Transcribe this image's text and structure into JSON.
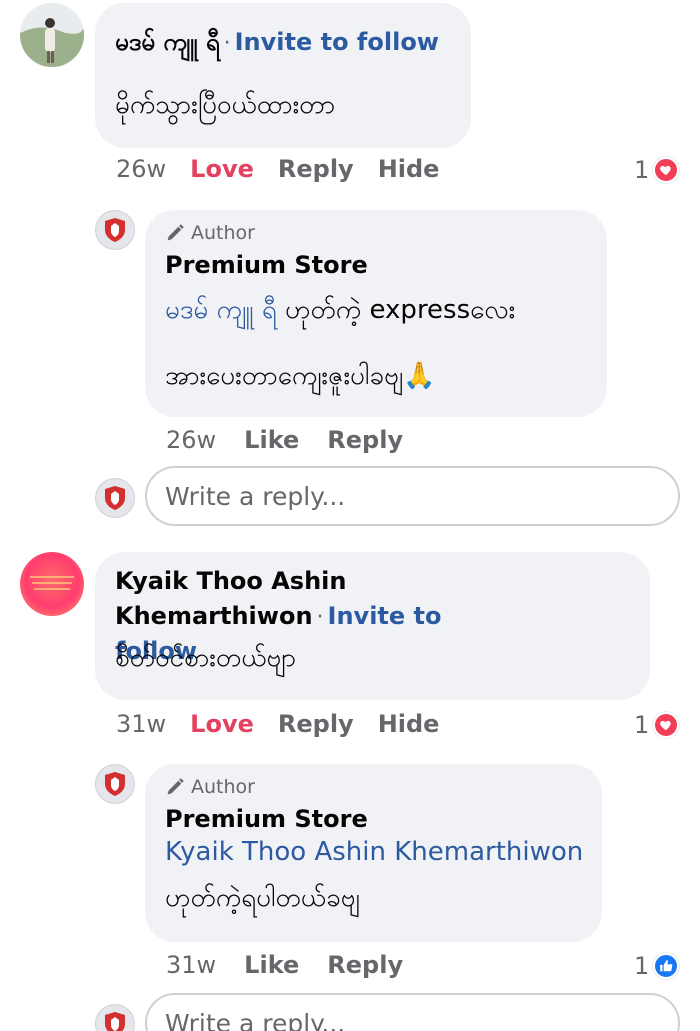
{
  "comments": [
    {
      "name": "မဒမ် ကျူ ရီ",
      "invite": "Invite to follow",
      "text": "မိုက်သွားပြီဝယ်ထားတာ",
      "time": "26w",
      "actions": [
        "Love",
        "Reply",
        "Hide"
      ],
      "reaction_count": "1",
      "reaction_icon": "heart-icon",
      "reply": {
        "badge": "Author",
        "name": "Premium Store",
        "mention": "မဒမ် ကျူ ရီ",
        "text_line1": " ဟုတ်ကဲ့ expressလေး",
        "text_line2": "အားပေးတာကျေးဇူးပါခဗျ🙏",
        "time": "26w",
        "actions": [
          "Like",
          "Reply"
        ]
      },
      "reply_placeholder": "Write a reply..."
    },
    {
      "name": "Kyaik Thoo Ashin Khemarthiwon",
      "invite_line1": "Invite to",
      "invite_line2": "follow",
      "text": "စိတ်ဝင်စားတယ်ဗျာ",
      "time": "31w",
      "actions": [
        "Love",
        "Reply",
        "Hide"
      ],
      "reaction_count": "1",
      "reaction_icon": "heart-icon",
      "reply": {
        "badge": "Author",
        "name": "Premium Store",
        "mention": "Kyaik Thoo Ashin Khemarthiwon",
        "text": "ဟုတ်ကဲ့ရပါတယ်ခဗျ",
        "time": "31w",
        "actions": [
          "Like",
          "Reply"
        ],
        "reaction_count": "1",
        "reaction_icon": "like-icon"
      },
      "reply_placeholder": "Write a reply..."
    }
  ],
  "colors": {
    "link": "#2c5aa0",
    "love": "#e4405f",
    "meta": "#65676b",
    "bubble": "#f0f2f5"
  }
}
